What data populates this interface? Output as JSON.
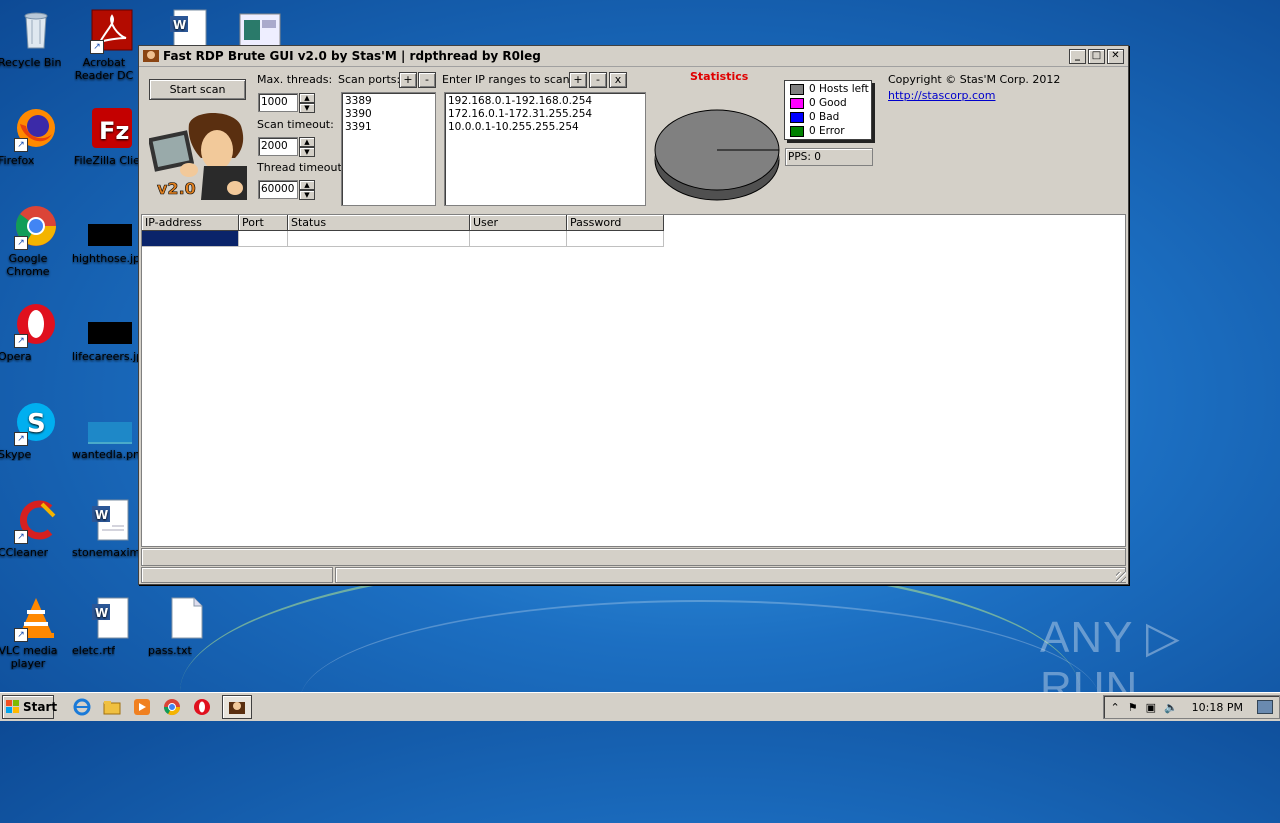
{
  "desktop": {
    "icons": [
      {
        "label": "Recycle Bin",
        "icon": "recycle-bin-icon"
      },
      {
        "label": "Acrobat Reader DC",
        "icon": "acrobat-icon"
      },
      {
        "label": "Firefox",
        "icon": "firefox-icon"
      },
      {
        "label": "FileZilla Client",
        "icon": "filezilla-icon"
      },
      {
        "label": "Google Chrome",
        "icon": "chrome-icon"
      },
      {
        "label": "highthose.jpg",
        "icon": "image-icon"
      },
      {
        "label": "Opera",
        "icon": "opera-icon"
      },
      {
        "label": "lifecareers.jpg",
        "icon": "image-icon"
      },
      {
        "label": "Skype",
        "icon": "skype-icon"
      },
      {
        "label": "wantedla.png",
        "icon": "image-icon"
      },
      {
        "label": "CCleaner",
        "icon": "ccleaner-icon"
      },
      {
        "label": "stonemaxim...",
        "icon": "word-doc-icon"
      },
      {
        "label": "VLC media player",
        "icon": "vlc-icon"
      },
      {
        "label": "eletc.rtf",
        "icon": "word-doc-icon"
      },
      {
        "label": "pass.txt",
        "icon": "text-file-icon"
      }
    ]
  },
  "window": {
    "title": "Fast RDP Brute GUI v2.0 by Stas'M | rdpthread by R0leg",
    "start_scan": "Start scan",
    "max_threads_label": "Max. threads:",
    "max_threads_value": "1000",
    "scan_timeout_label": "Scan timeout:",
    "scan_timeout_value": "2000",
    "thread_timeout_label": "Thread timeout:",
    "thread_timeout_value": "60000",
    "scan_ports_label": "Scan ports:",
    "ports": "3389\n3390\n3391",
    "ip_ranges_label": "Enter IP ranges to scan:",
    "ip_ranges": "192.168.0.1-192.168.0.254\n172.16.0.1-172.31.255.254\n10.0.0.1-10.255.255.254",
    "plus": "+",
    "minus": "-",
    "clear": "x",
    "statistics_label": "Statistics",
    "legend": [
      {
        "label": "0 Hosts left",
        "color": "#808080"
      },
      {
        "label": "0 Good",
        "color": "#ff00ff"
      },
      {
        "label": "0 Bad",
        "color": "#0000ff"
      },
      {
        "label": "0 Error",
        "color": "#008000"
      }
    ],
    "pps": "PPS: 0",
    "copyright": "Copyright © Stas'M Corp. 2012",
    "link": "http://stascorp.com",
    "logo_version": "v2.0",
    "columns": [
      "IP-address",
      "Port",
      "Status",
      "User",
      "Password"
    ]
  },
  "taskbar": {
    "start": "Start",
    "clock": "10:18 PM"
  },
  "watermark": "ANY ▷ RUN"
}
